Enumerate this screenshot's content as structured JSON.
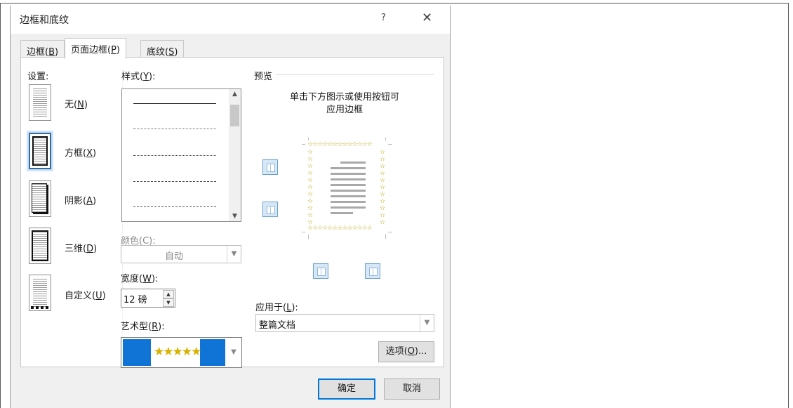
{
  "dialog": {
    "title": "边框和底纹",
    "help": "?",
    "close": "✕"
  },
  "tabs": [
    {
      "text": "边框(",
      "key": "B",
      "suffix": ")"
    },
    {
      "text": "页面边框(",
      "key": "P",
      "suffix": ")"
    },
    {
      "text": "底纹(",
      "key": "S",
      "suffix": ")"
    }
  ],
  "settings": {
    "heading": "设置:",
    "items": [
      {
        "text": "无(",
        "key": "N",
        "suffix": ")"
      },
      {
        "text": "方框(",
        "key": "X",
        "suffix": ")"
      },
      {
        "text": "阴影(",
        "key": "A",
        "suffix": ")"
      },
      {
        "text": "三维(",
        "key": "D",
        "suffix": ")"
      },
      {
        "text": "自定义(",
        "key": "U",
        "suffix": ")"
      }
    ],
    "selected_index": 1
  },
  "style": {
    "label": "样式(",
    "key": "Y",
    "suffix": "):",
    "color_label": "颜色(C):",
    "color_value": "自动",
    "width_label": "宽度(",
    "width_key": "W",
    "width_suffix": "):",
    "width_value": "12 磅",
    "art_label": "艺术型(",
    "art_key": "R",
    "art_suffix": "):",
    "art_value": "★★★★★"
  },
  "preview": {
    "label": "预览",
    "hint_line1": "单击下方图示或使用按钮可",
    "hint_line2": "应用边框",
    "apply_label": "应用于(",
    "apply_key": "L",
    "apply_suffix": "):",
    "apply_value": "整篇文档",
    "options_text": "选项(",
    "options_key": "O",
    "options_suffix": ")..."
  },
  "buttons": {
    "ok": "确定",
    "cancel": "取消"
  },
  "colors": {
    "accent": "#0078d7",
    "art_star": "#d7b300",
    "selection": "#0f74d6"
  }
}
